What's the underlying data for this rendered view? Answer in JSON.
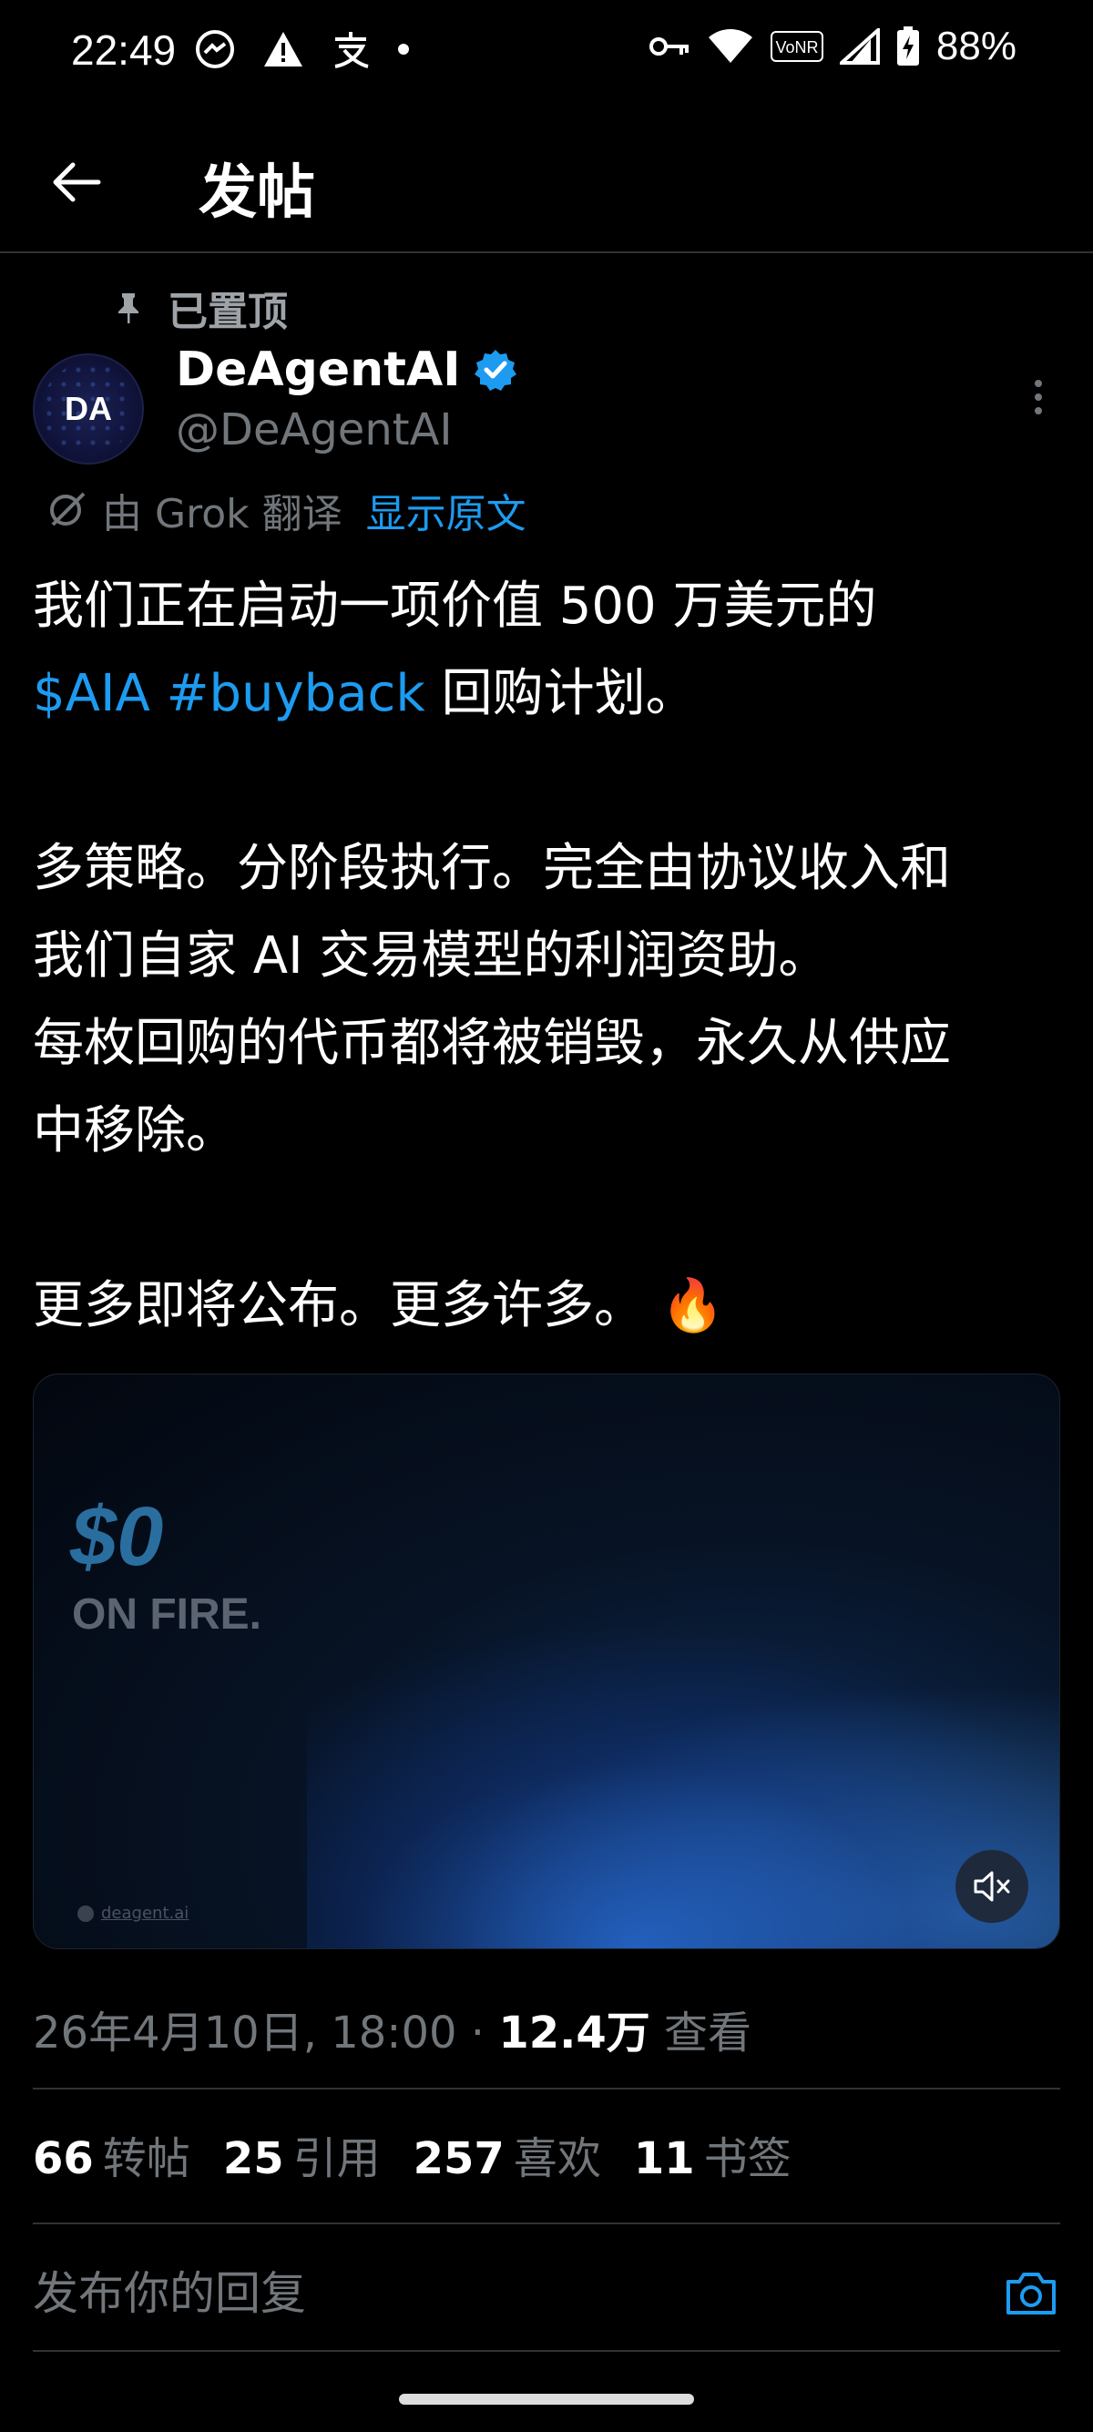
{
  "status_bar": {
    "time": "22:49",
    "battery": "88%"
  },
  "header": {
    "title": "发帖"
  },
  "pinned": {
    "label": "已置顶"
  },
  "author": {
    "name": "DeAgentAI",
    "handle": "@DeAgentAI",
    "avatar_text": "DA"
  },
  "translate": {
    "text": "由 Grok 翻译",
    "show_original": "显示原文"
  },
  "tweet": {
    "line1": "我们正在启动一项价值 500 万美元的",
    "cashtag": "$AIA",
    "hashtag": "#buyback",
    "line2_rest": " 回购计划。",
    "line3": "多策略。分阶段执行。完全由协议收入和",
    "line4": "我们自家 AI 交易模型的利润资助。",
    "line5": "每枚回购的代币都将被销毁，永久从供应",
    "line6": "中移除。",
    "line7": "更多即将公布。更多许多。",
    "emoji": "🔥"
  },
  "media": {
    "title": "$0",
    "subtitle": "ON FIRE.",
    "watermark": "deagent.ai"
  },
  "meta": {
    "datetime": "26年4月10日, 18:00 · ",
    "views_count": "12.4万",
    "views_label": " 查看"
  },
  "stats": [
    {
      "count": "66",
      "label": "转帖"
    },
    {
      "count": "25",
      "label": "引用"
    },
    {
      "count": "257",
      "label": "喜欢"
    },
    {
      "count": "11",
      "label": "书签"
    }
  ],
  "reply": {
    "placeholder": "发布你的回复"
  },
  "colors": {
    "accent": "#1d9bf0",
    "muted": "#71767b",
    "divider": "#2f3336",
    "background": "#000000"
  }
}
